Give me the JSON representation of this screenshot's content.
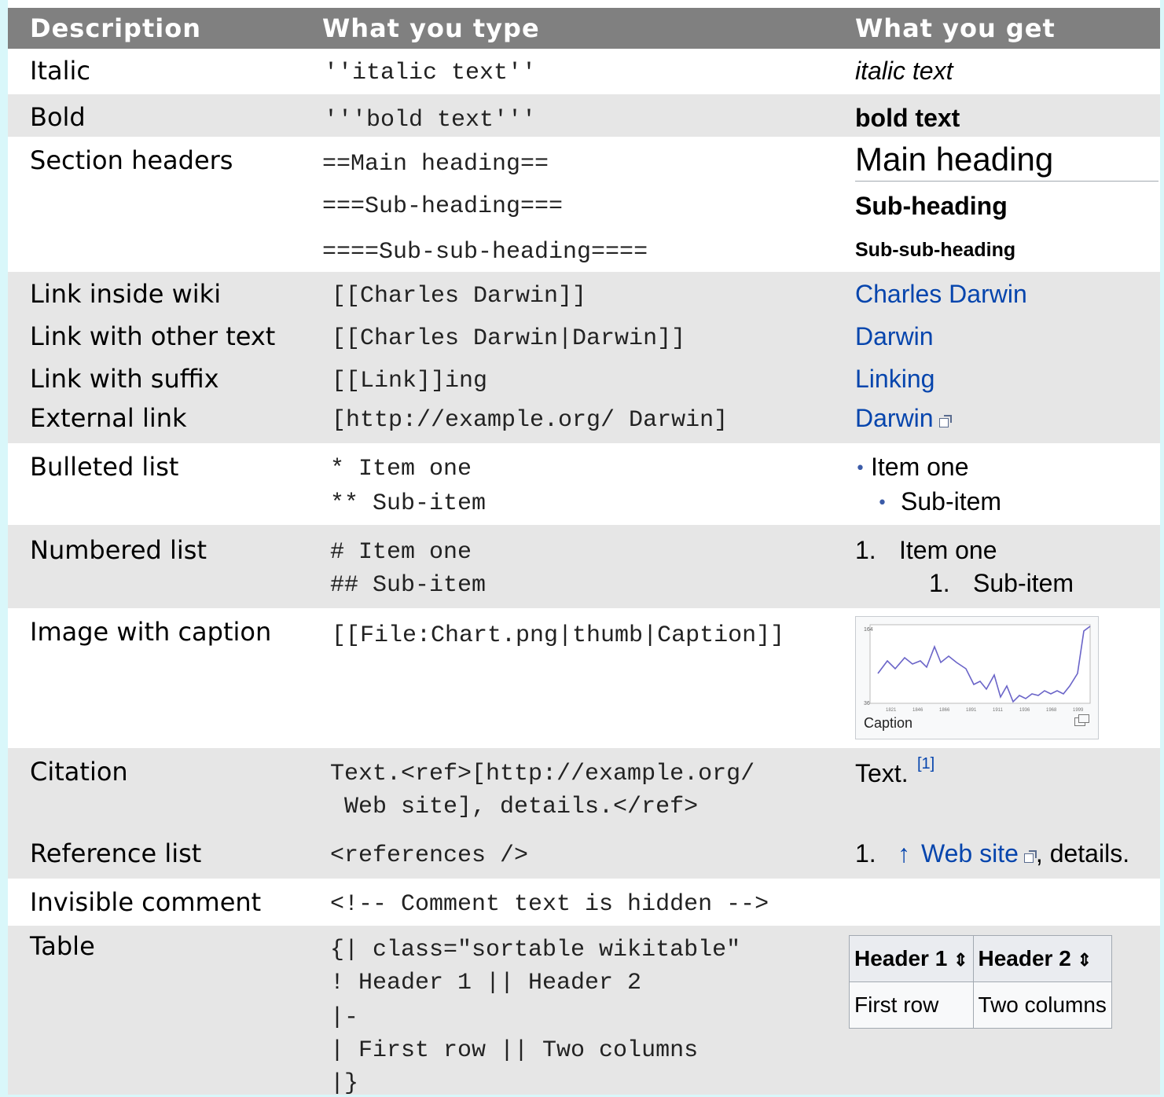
{
  "headers": {
    "description": "Description",
    "type": "What you type",
    "get": "What you get"
  },
  "rows": {
    "italic": {
      "desc": "Italic",
      "code": "''italic text''",
      "result": "italic text"
    },
    "bold": {
      "desc": "Bold",
      "code": "'''bold text'''",
      "result": "bold text"
    },
    "section": {
      "desc": "Section headers",
      "code1": "==Main heading==",
      "code2": "===Sub-heading===",
      "code3": "====Sub-sub-heading====",
      "r1": "Main heading",
      "r2": "Sub-heading",
      "r3": "Sub-sub-heading"
    },
    "links": {
      "d1": "Link inside wiki",
      "c1": "[[Charles Darwin]]",
      "r1": "Charles Darwin",
      "d2": "Link with other text",
      "c2": "[[Charles Darwin|Darwin]]",
      "r2": "Darwin",
      "d3": "Link with suffix",
      "c3": "[[Link]]ing",
      "r3": "Linking",
      "d4": "External link",
      "c4": "[http://example.org/ Darwin]",
      "r4": "Darwin"
    },
    "bulleted": {
      "desc": "Bulleted list",
      "c1": "* Item one",
      "c2": "** Sub-item",
      "bullet": "•",
      "r1": "Item one",
      "r2": "Sub-item"
    },
    "numbered": {
      "desc": "Numbered list",
      "c1": "# Item one",
      "c2": "## Sub-item",
      "n1": "1.",
      "r1": "Item one",
      "n2": "1.",
      "r2": "Sub-item"
    },
    "image": {
      "desc": "Image with caption",
      "code": "[[File:Chart.png|thumb|Caption]]",
      "caption": "Caption",
      "y_top": "164",
      "y_bottom": "36",
      "x_ticks": [
        "1821",
        "1846",
        "1866",
        "1891",
        "1911",
        "1936",
        "1968",
        "1999"
      ]
    },
    "citation": {
      "desc": "Citation",
      "c1": "Text.<ref>[http://example.org/",
      "c2": " Web site], details.</ref>",
      "result": "Text.",
      "sup": "[1]"
    },
    "reflist": {
      "desc": "Reference list",
      "code": "<references />",
      "num": "1.",
      "arrow": "↑",
      "link": "Web site",
      "tail": ", details."
    },
    "comment": {
      "desc": "Invisible comment",
      "code": "<!-- Comment text is hidden -->"
    },
    "table": {
      "desc": "Table",
      "c1": "{| class=\"sortable wikitable\"",
      "c2": "! Header 1 || Header 2",
      "c3": "|-",
      "c4": "| First row || Two columns",
      "c5": "|}",
      "h1": "Header 1",
      "h2": "Header 2",
      "sort": "⇕",
      "d1": "First row",
      "d2": "Two columns"
    }
  },
  "colors": {
    "link": "#0645ad",
    "header_bg": "#808080",
    "band": "#e6e6e6",
    "page_bg": "#d9f7fa"
  }
}
